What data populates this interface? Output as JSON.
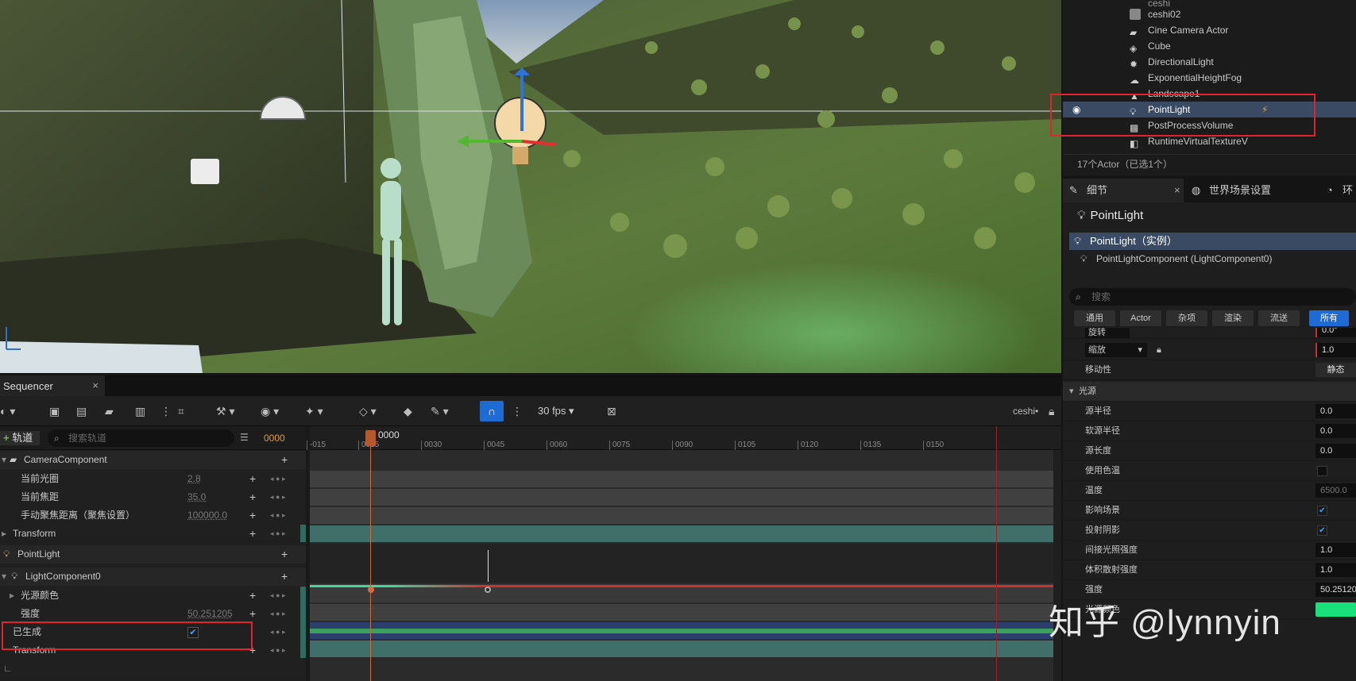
{
  "outliner": {
    "items": [
      {
        "name": "ceshi02",
        "icon": "level-sequence-icon"
      },
      {
        "name": "Cine Camera Actor",
        "icon": "camera-icon"
      },
      {
        "name": "Cube",
        "icon": "cube-icon"
      },
      {
        "name": "DirectionalLight",
        "icon": "sun-icon"
      },
      {
        "name": "ExponentialHeightFog",
        "icon": "fog-icon"
      },
      {
        "name": "Landscape1",
        "icon": "landscape-icon"
      },
      {
        "name": "PointLight",
        "icon": "bulb-icon",
        "selected": true,
        "badge": "⚡"
      },
      {
        "name": "PostProcessVolume",
        "icon": "volume-icon"
      },
      {
        "name": "RuntimeVirtualTextureV",
        "icon": "texture-icon"
      }
    ],
    "count": "17个Actor（已选1个）"
  },
  "details": {
    "tabs": [
      "细节",
      "世界场景设置",
      "环"
    ],
    "title": "PointLight",
    "instance": "PointLight（实例）",
    "component": "PointLightComponent (LightComponent0)",
    "search_placeholder": "搜索",
    "filters": [
      "通用",
      "Actor",
      "杂项",
      "渲染",
      "流送",
      "所有"
    ],
    "transform": {
      "rotate_label": "旋转",
      "rotate_value": "0.0°",
      "scale_label": "缩放",
      "scale_value": "1.0"
    },
    "mobility": {
      "label": "移动性",
      "value": "静态"
    },
    "section_light": "光源",
    "props": [
      {
        "label": "源半径",
        "value": "0.0"
      },
      {
        "label": "软源半径",
        "value": "0.0"
      },
      {
        "label": "源长度",
        "value": "0.0"
      },
      {
        "label": "使用色温",
        "check": false
      },
      {
        "label": "温度",
        "value": "6500.0"
      },
      {
        "label": "影响场景",
        "check": true
      },
      {
        "label": "投射阴影",
        "check": true
      },
      {
        "label": "间接光照强度",
        "value": "1.0"
      },
      {
        "label": "体积散射强度",
        "value": "1.0"
      },
      {
        "label": "强度",
        "value": "50.25120"
      },
      {
        "label": "光源颜色",
        "color": "#19e07a"
      }
    ]
  },
  "sequencer": {
    "tab": "Sequencer",
    "fps": "30 fps",
    "sequence_name": "ceshi•",
    "add_track": "轨道",
    "search_placeholder": "搜索轨道",
    "current_frame": "0000",
    "playhead": "0000",
    "ticks": [
      "-015",
      "0015",
      "0030",
      "0045",
      "0060",
      "0075",
      "0090",
      "0105",
      "0120",
      "0135",
      "0150"
    ],
    "tracks": [
      {
        "label": "CameraComponent",
        "type": "group"
      },
      {
        "label": "当前光圈",
        "value": "2.8"
      },
      {
        "label": "当前焦距",
        "value": "35.0"
      },
      {
        "label": "手动聚焦距离（聚焦设置）",
        "value": "100000.0"
      },
      {
        "label": "Transform",
        "type": "sub"
      },
      {
        "label": "PointLight",
        "type": "group"
      },
      {
        "label": "LightComponent0",
        "type": "group"
      },
      {
        "label": "光源颜色",
        "type": "sub"
      },
      {
        "label": "强度",
        "value": "50.251205"
      },
      {
        "label": "已生成",
        "check": true
      },
      {
        "label": "Transform",
        "type": "sub"
      }
    ]
  },
  "watermark": "知乎 @lynnyin"
}
